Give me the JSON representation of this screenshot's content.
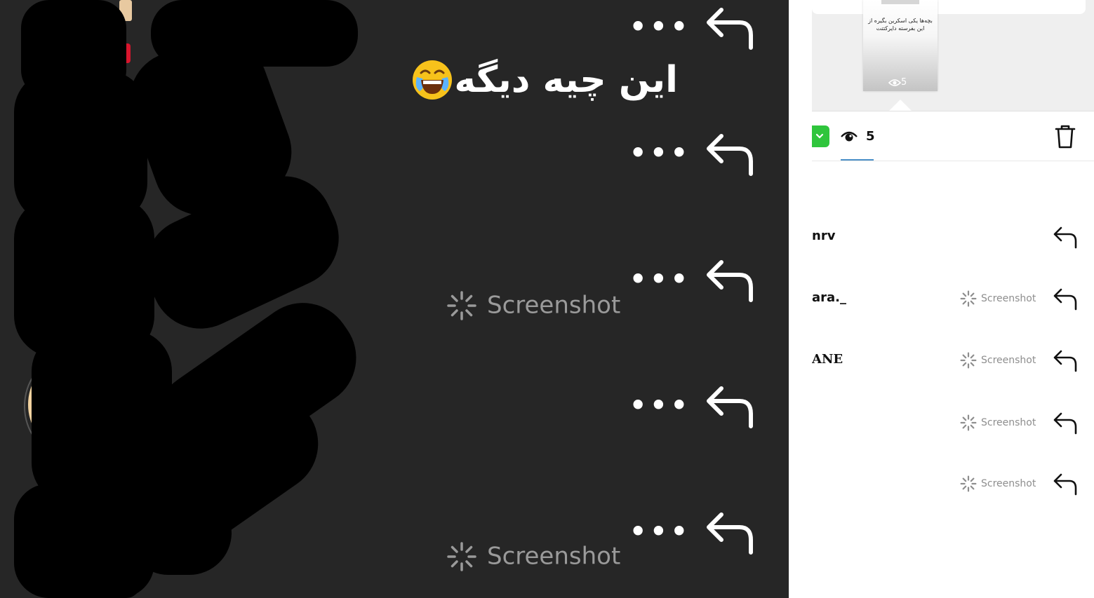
{
  "left_panel": {
    "message_text": "این چیه دیگه",
    "message_emoji": "face-with-tears-of-joy",
    "more_label": "•••",
    "screenshot_label": "Screenshot",
    "rows": [
      {
        "has_message": true,
        "has_screenshot": false
      },
      {
        "has_message": false,
        "has_screenshot": false
      },
      {
        "has_message": false,
        "has_screenshot": true
      },
      {
        "has_message": false,
        "has_screenshot": false
      },
      {
        "has_message": false,
        "has_screenshot": true
      }
    ]
  },
  "right_panel": {
    "story_preview": {
      "text": "بچه‌ها یکی اسکرین بگیره از این بفرسته دایرکتتت",
      "views": "5"
    },
    "toolbar": {
      "views_count": "5"
    },
    "viewers": [
      {
        "username": "nrv",
        "screenshot": false
      },
      {
        "username": "ara._",
        "screenshot": true
      },
      {
        "username": "ANE",
        "screenshot": true
      },
      {
        "username": "",
        "screenshot": true
      },
      {
        "username": "",
        "screenshot": true
      }
    ],
    "screenshot_label": "Screenshot"
  },
  "colors": {
    "dark_bg": "#262626",
    "green": "#2fc53c",
    "screenshot_gray": "#8e8e8e"
  }
}
